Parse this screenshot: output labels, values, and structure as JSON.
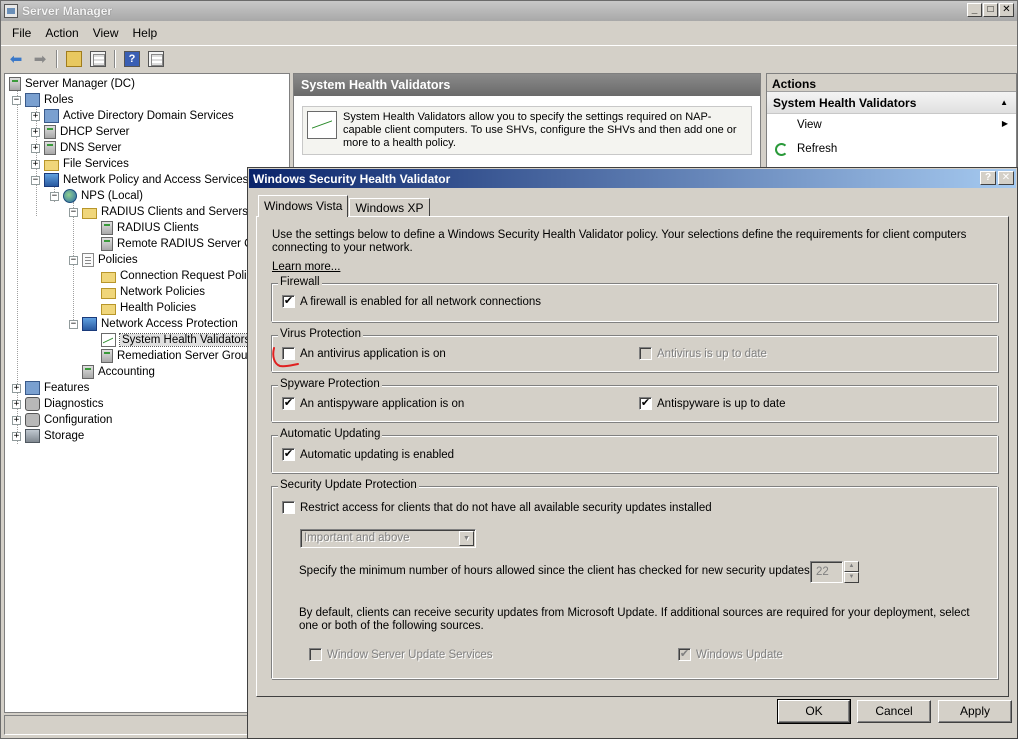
{
  "window": {
    "title": "Server Manager"
  },
  "menu": [
    "File",
    "Action",
    "View",
    "Help"
  ],
  "tree": [
    {
      "label": "Server Manager (DC)",
      "icon": "server-icon"
    },
    {
      "label": "Roles",
      "icon": "roles-icon"
    },
    {
      "label": "Active Directory Domain Services",
      "icon": "ad-icon"
    },
    {
      "label": "DHCP Server",
      "icon": "dhcp-icon"
    },
    {
      "label": "DNS Server",
      "icon": "dns-icon"
    },
    {
      "label": "File Services",
      "icon": "folder-icon"
    },
    {
      "label": "Network Policy and Access Services",
      "icon": "npas-icon"
    },
    {
      "label": "NPS (Local)",
      "icon": "globe-icon"
    },
    {
      "label": "RADIUS Clients and Servers",
      "icon": "folder-icon"
    },
    {
      "label": "RADIUS Clients",
      "icon": "server-icon"
    },
    {
      "label": "Remote RADIUS Server G",
      "icon": "server-icon"
    },
    {
      "label": "Policies",
      "icon": "document-icon"
    },
    {
      "label": "Connection Request Polici",
      "icon": "folder-icon"
    },
    {
      "label": "Network Policies",
      "icon": "folder-icon"
    },
    {
      "label": "Health Policies",
      "icon": "folder-icon"
    },
    {
      "label": "Network Access Protection",
      "icon": "nap-icon"
    },
    {
      "label": "System Health Validators",
      "icon": "chart-icon"
    },
    {
      "label": "Remediation Server Group",
      "icon": "server-icon"
    },
    {
      "label": "Accounting",
      "icon": "accounting-icon"
    },
    {
      "label": "Features",
      "icon": "features-icon"
    },
    {
      "label": "Diagnostics",
      "icon": "diagnostics-icon"
    },
    {
      "label": "Configuration",
      "icon": "configuration-icon"
    },
    {
      "label": "Storage",
      "icon": "storage-icon"
    }
  ],
  "center": {
    "title": "System Health Validators",
    "description": "System Health Validators allow you to specify the settings required on NAP-capable client computers. To use SHVs, configure the SHVs and then add one or more to a health policy."
  },
  "actions": {
    "header": "Actions",
    "section": "System Health Validators",
    "items": [
      "View",
      "Refresh"
    ]
  },
  "dialog": {
    "title": "Windows Security Health Validator",
    "help_btn": "?",
    "close_btn": "✕",
    "tabs": [
      "Windows Vista",
      "Windows XP"
    ],
    "intro": "Use the settings below to define a Windows Security Health Validator policy. Your selections define the requirements for client computers connecting to your network.",
    "learn_more": "Learn more...",
    "firewall": {
      "legend": "Firewall",
      "enabled_label": "A firewall is enabled for all network connections",
      "enabled_checked": "✔"
    },
    "virus": {
      "legend": "Virus Protection",
      "on_label": "An antivirus application is on",
      "on_checked": "",
      "uptodate_label": "Antivirus is up to date",
      "uptodate_checked": ""
    },
    "spyware": {
      "legend": "Spyware Protection",
      "on_label": "An antispyware application is on",
      "on_checked": "✔",
      "uptodate_label": "Antispyware is up to date",
      "uptodate_checked": "✔"
    },
    "updating": {
      "legend": "Automatic Updating",
      "enabled_label": "Automatic updating is enabled",
      "enabled_checked": "✔"
    },
    "security_updates": {
      "legend": "Security Update Protection",
      "restrict_label": "Restrict access for clients that do not have all available security updates installed",
      "restrict_checked": "",
      "severity_value": "Important and above",
      "hours_label": "Specify the minimum number of hours allowed since the client has checked for new security updates:",
      "hours_value": "22",
      "default_text": "By default, clients can receive security updates from Microsoft Update.  If additional sources are required for your deployment, select one or both of the following sources.",
      "wsus_label": "Window Server Update Services",
      "wsus_checked": "",
      "wu_label": "Windows Update",
      "wu_checked": "✔"
    },
    "buttons": {
      "ok": "OK",
      "cancel": "Cancel",
      "apply": "Apply"
    }
  },
  "colors": {
    "dialog_title_start": "#0a246a",
    "dialog_title_end": "#a6caf0",
    "annotation": "#e02020"
  }
}
